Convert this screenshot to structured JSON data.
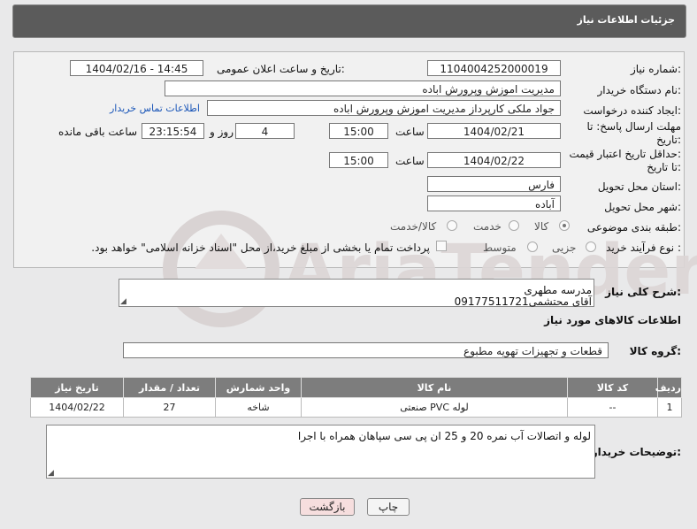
{
  "header": {
    "title": "جزئیات اطلاعات نیاز"
  },
  "form": {
    "need_number_label": "شماره نیاز:",
    "need_number": "1104004252000019",
    "announce_label": "تاریخ و ساعت اعلان عمومی:",
    "announce_value": "1404/02/16 - 14:45",
    "buyer_org_label": "نام دستگاه خریدار:",
    "buyer_org": "مدیریت اموزش وپرورش اباده",
    "requester_label": "ایجاد کننده درخواست:",
    "requester": "جواد ملکی کارپرداز مدیریت اموزش وپرورش اباده",
    "buyer_contact_link": "اطلاعات تماس خریدار",
    "deadline_label_1": "مهلت ارسال پاسخ: تا",
    "deadline_label_2": "تاریخ:",
    "deadline_date": "1404/02/21",
    "time_label": "ساعت",
    "deadline_time": "15:00",
    "days_value": "4",
    "days_label": "روز و",
    "remaining_value": "23:15:54",
    "remaining_label": "ساعت باقی مانده",
    "price_label_1": "حداقل تاریخ اعتبار قیمت:",
    "price_label_2": "تا تاریخ:",
    "price_date": "1404/02/22",
    "price_time": "15:00",
    "province_label": "استان محل تحویل:",
    "province": "فارس",
    "city_label": "شهر محل تحویل:",
    "city": "آباده",
    "category_label": "طبقه بندی موضوعی:",
    "category_options": [
      "کالا",
      "خدمت",
      "کالا/خدمت"
    ],
    "category_selected": "کالا",
    "process_label": "نوع فرآیند خرید :",
    "process_options": [
      "جزیی",
      "متوسط"
    ],
    "payment_note": "پرداخت تمام یا بخشی از مبلغ خرید،از محل \"اسناد خزانه اسلامی\" خواهد بود."
  },
  "description": {
    "label": "شرح کلی نیاز:",
    "line1": "مدرسه مطهری",
    "line2": "آقای محتشمی09177511721"
  },
  "goods": {
    "section_title": "اطلاعات کالاهای مورد نیاز",
    "group_label": "گروه کالا:",
    "group_value": "قطعات و تجهیزات تهویه مطبوع"
  },
  "table": {
    "headers": [
      "ردیف",
      "کد کالا",
      "نام کالا",
      "واحد شمارش",
      "تعداد / مقدار",
      "تاریخ نیاز"
    ],
    "rows": [
      [
        "1",
        "--",
        "لوله PVC صنعتی",
        "شاخه",
        "27",
        "1404/02/22"
      ]
    ]
  },
  "buyer_notes": {
    "label": "توضیحات خریدار:",
    "text": "لوله و اتصالات آب نمره 20 و 25 ان پی سی سپاهان همراه با اجرا"
  },
  "buttons": {
    "print": "چاپ",
    "back": "بازگشت"
  },
  "watermark": {
    "text": "AriaTender.neT"
  },
  "colors": {
    "header_bg": "#5b5b5b",
    "link": "#1a56b8",
    "back_button_bg": "#f6dede"
  }
}
